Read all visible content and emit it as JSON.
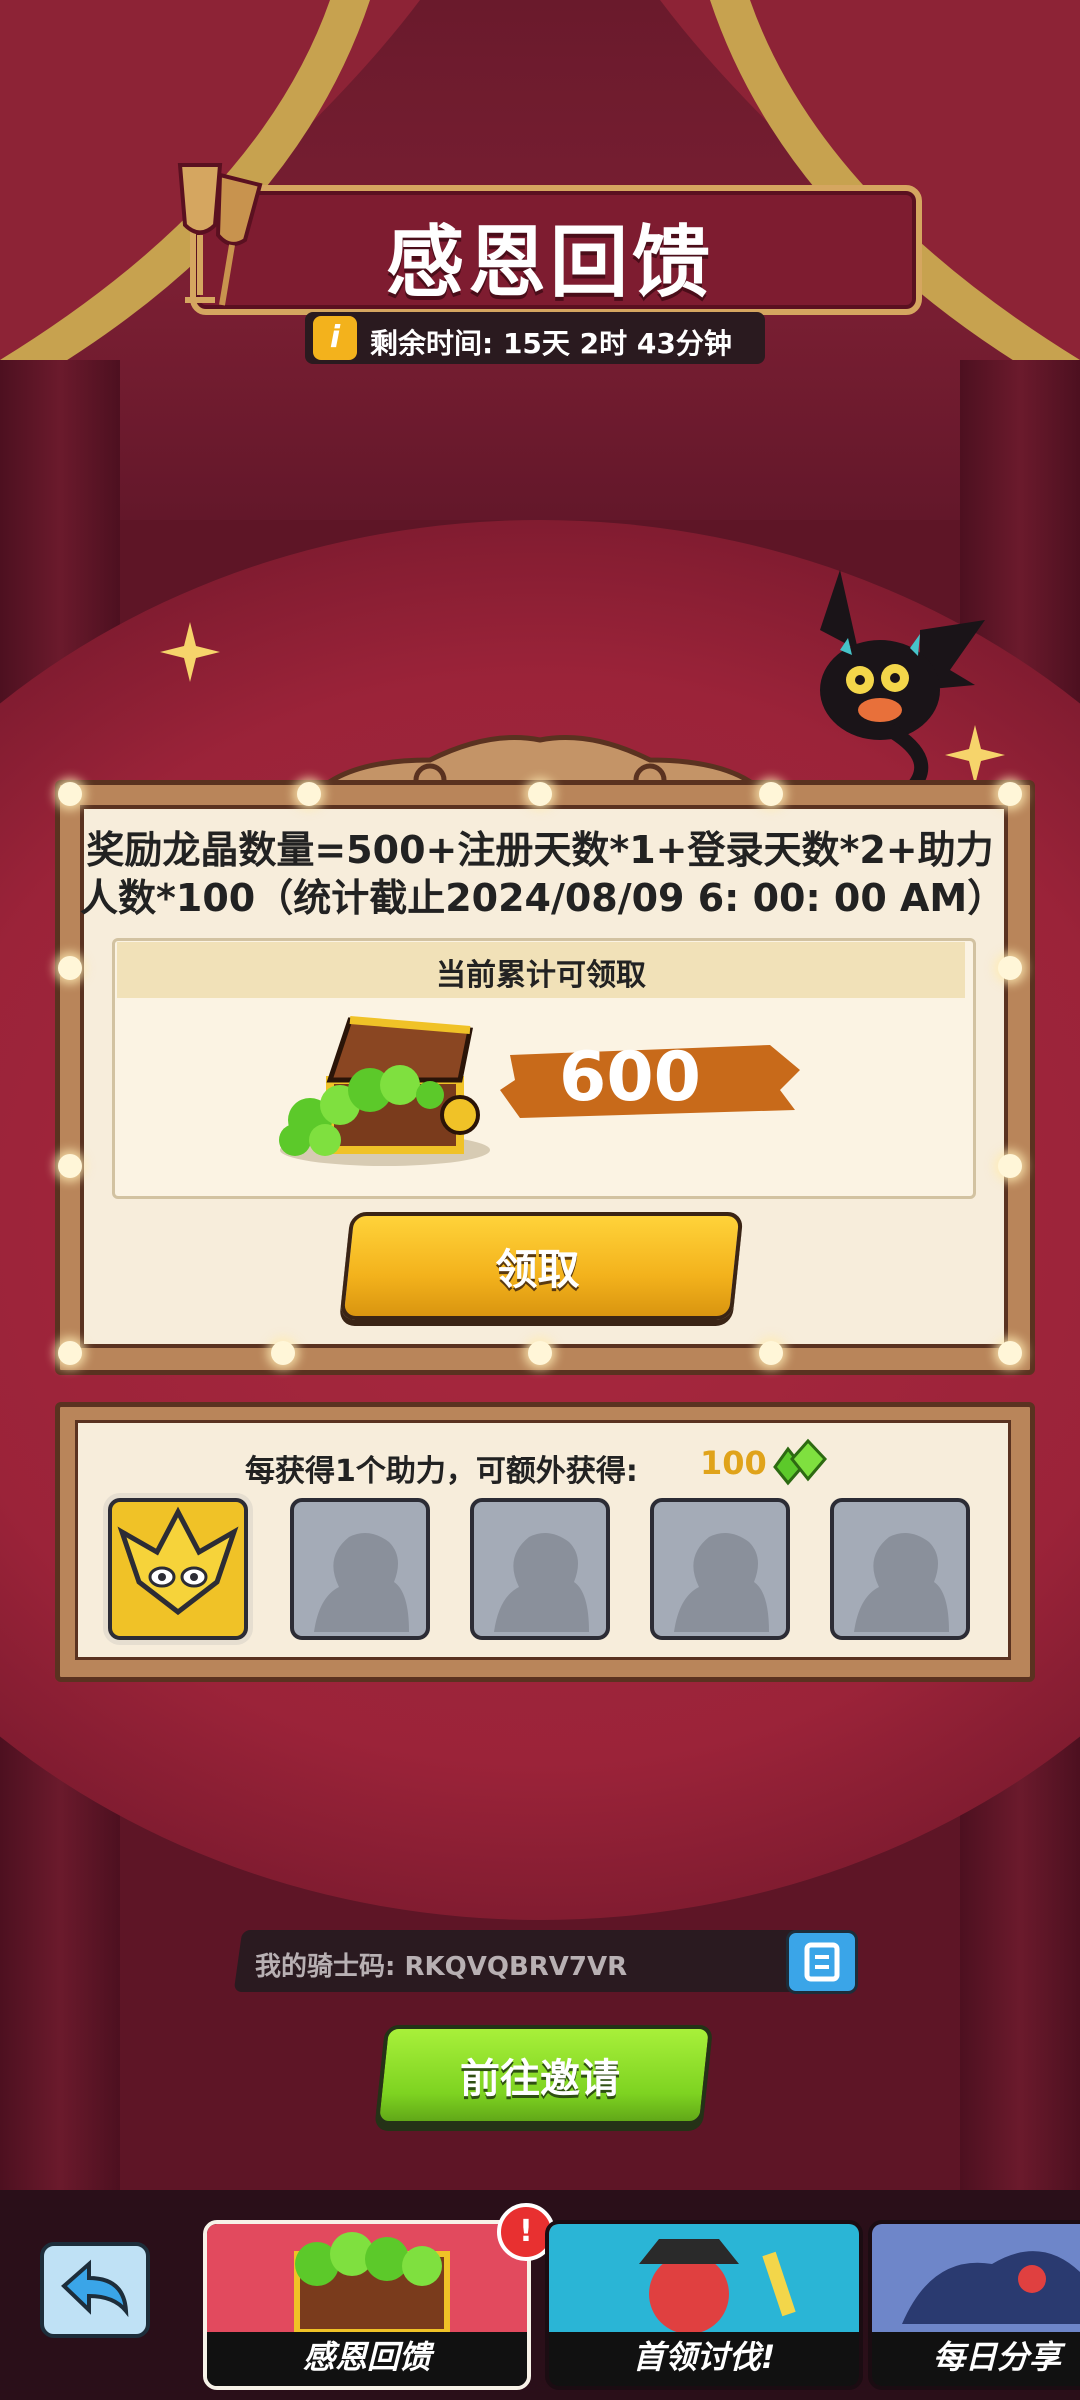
{
  "header": {
    "title": "感恩回馈",
    "timer_label": "剩余时间: 15天 2时 43分钟"
  },
  "reward": {
    "formula": "奖励龙晶数量=500+注册天数*1+登录天数*2+助力人数*100（统计截止2024/08/09 6: 00: 00 AM）",
    "section_label": "当前累计可领取",
    "amount": "600",
    "claim_label": "领取"
  },
  "helpers": {
    "text": "每获得1个助力，可额外获得:",
    "bonus_value": "100",
    "slots_filled": 1,
    "slots_total": 5
  },
  "knight_code": {
    "text": "我的骑士码: RKQVQBRV7VR"
  },
  "invite": {
    "label": "前往邀请"
  },
  "tabs": [
    {
      "label": "感恩回馈"
    },
    {
      "label": "首领讨伐!"
    },
    {
      "label": "每日分享"
    }
  ],
  "badge": "!",
  "colors": {
    "background": "#5e1526",
    "gold_button": "#f3b21c",
    "green_button": "#7ed321",
    "amount_brush": "#c86a1a",
    "gem": "#5cc92a"
  }
}
